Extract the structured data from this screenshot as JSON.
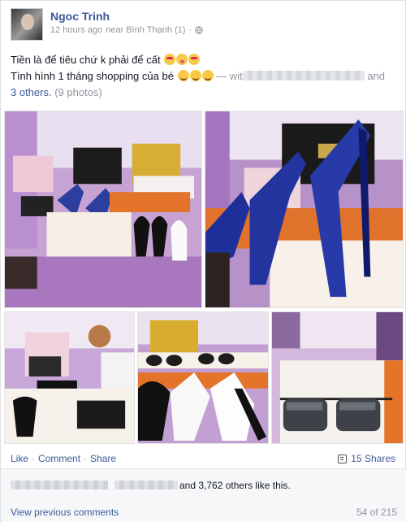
{
  "post": {
    "author": "Ngoc Trinh",
    "time": "12 hours ago",
    "location": "near Bình Thạnh (1)",
    "meta_separator": "·",
    "privacy_icon": "globe-icon",
    "line1": "Tiền là để tiêu chứ k phải để cất",
    "line1_emojis": [
      "heart-eyes-emoji",
      "tongue-emoji",
      "heart-eyes-emoji"
    ],
    "line2": "Tình hình 1 tháng shopping của bé",
    "line2_emojis": [
      "wink-emoji",
      "wink-emoji",
      "wink-emoji"
    ],
    "with_prefix": "— wit",
    "with_and": "and",
    "others_link": "3 others.",
    "photos_count": "(9 photos)"
  },
  "photos": [
    {
      "name": "handbags-heels-photo"
    },
    {
      "name": "blue-heels-photo"
    },
    {
      "name": "dior-bags-photo"
    },
    {
      "name": "sunglasses-heels-photo"
    },
    {
      "name": "dior-sunglasses-photo"
    }
  ],
  "actions": {
    "like": "Like",
    "comment": "Comment",
    "share": "Share",
    "separator": "·",
    "shares": "15 Shares"
  },
  "likes": {
    "text": "and 3,762 others like this."
  },
  "comments": {
    "view_previous": "View previous comments",
    "counter": "54 of 215"
  },
  "colors": {
    "link": "#3b5998",
    "meta": "#90949c",
    "footer_bg": "#f6f7f9"
  }
}
